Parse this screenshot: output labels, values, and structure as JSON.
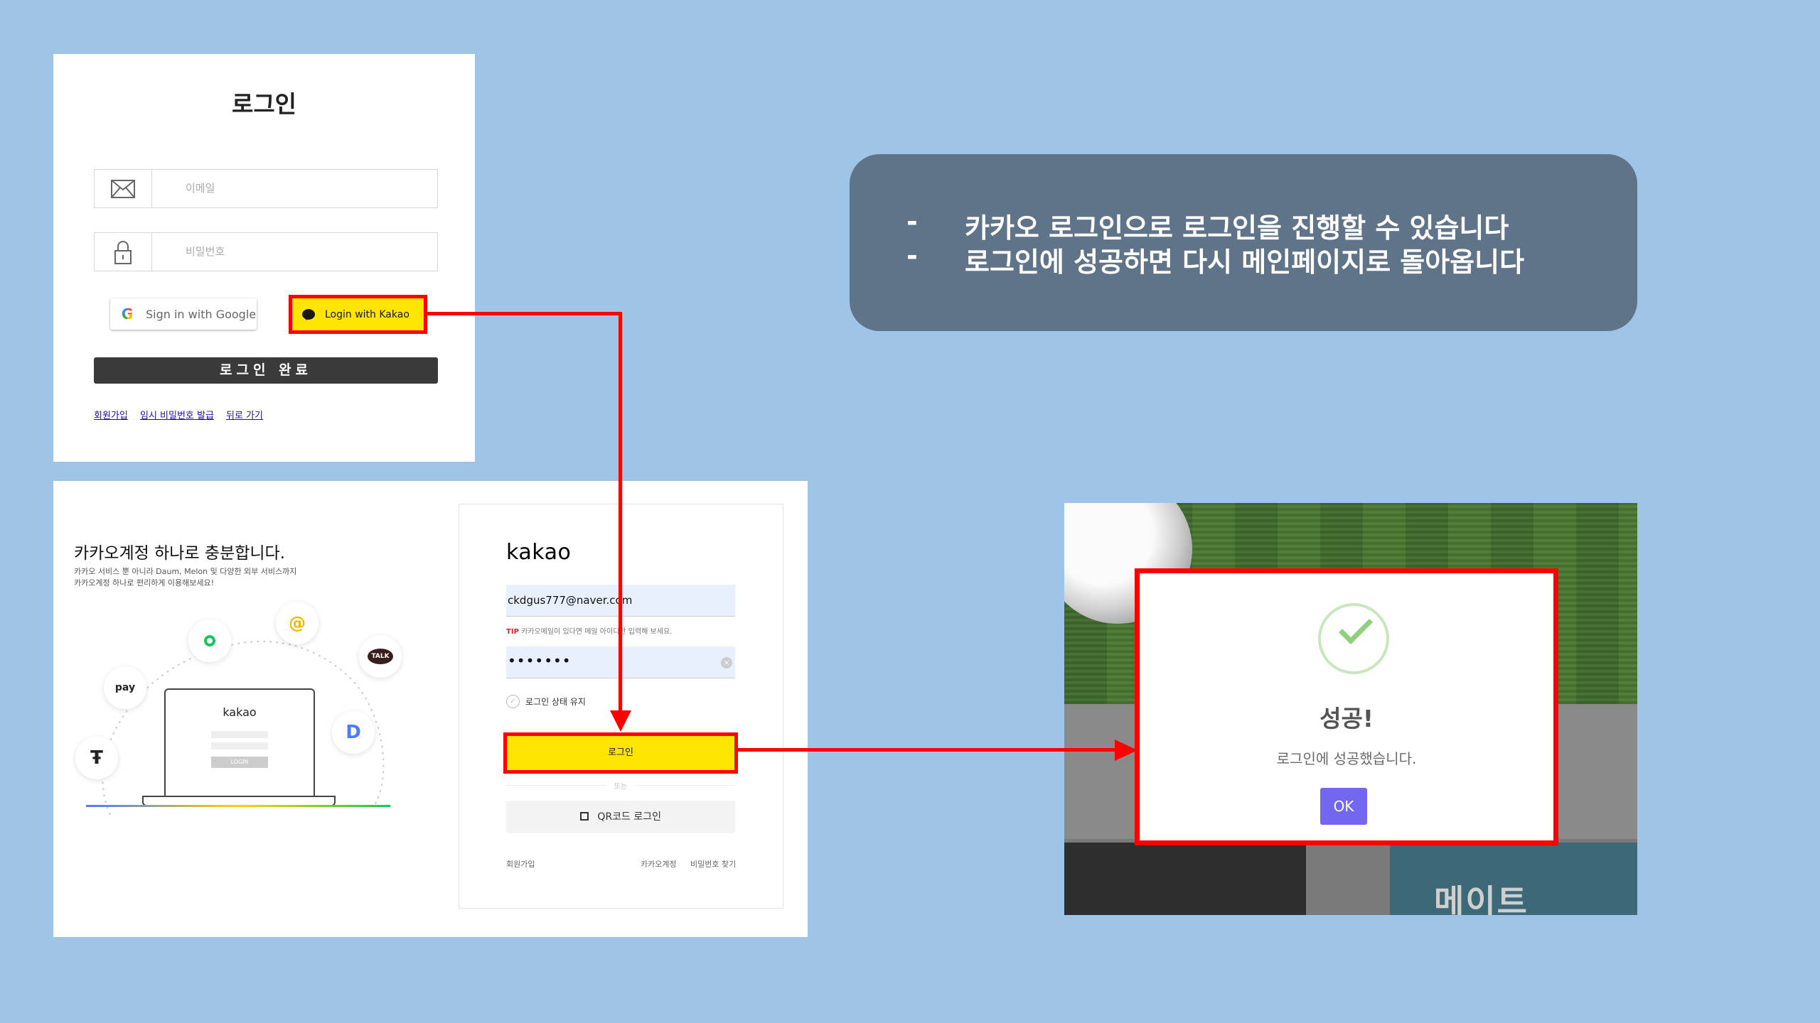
{
  "site_login": {
    "title": "로그인",
    "email_placeholder": "이메일",
    "password_placeholder": "비밀번호",
    "google_button": "Sign in with Google",
    "kakao_button": "Login with Kakao",
    "submit_button": "로그인 완료",
    "links": [
      "회원가입",
      "임시 비밀번호 발급",
      "뒤로 가기"
    ]
  },
  "kakao_page": {
    "heading": "카카오계정 하나로 충분합니다.",
    "sub1": "카카오 서비스 뿐 아니라 Daum, Melon 및 다양한 외부 서비스까지",
    "sub2": "카카오계정 하나로 편리하게 이용해보세요!",
    "icons": [
      "pay",
      "TALK",
      "@"
    ],
    "laptop_label": "kakao",
    "laptop_login": "LOGIN",
    "logo": "kakao",
    "email_value": "ckdgus777@naver.com",
    "tip_label": "TIP",
    "tip_text": "카카오메일이 있다면 메일 아이디만 입력해 보세요.",
    "password_value": "•••••••",
    "keep_login": "로그인 상태 유지",
    "login_button": "로그인",
    "or_text": "또는",
    "qr_button": "QR코드 로그인",
    "footer_signup": "회원가입",
    "footer_account": "카카오계정",
    "footer_find_pw": "비밀번호 찾기"
  },
  "info": {
    "dash": "-",
    "line1": "카카오 로그인으로 로그인을 진행할 수 있습니다",
    "line2": "로그인에 성공하면 다시 메인페이지로 돌아옵니다"
  },
  "success": {
    "title": "성공!",
    "message": "로그인에 성공했습니다.",
    "ok_button": "OK",
    "background_text": "메이트"
  },
  "colors": {
    "background": "#a0c4e8",
    "highlight": "#ff0000",
    "kakao_yellow": "#fee500",
    "info_box": "#607489",
    "ok_button": "#7367f0"
  }
}
